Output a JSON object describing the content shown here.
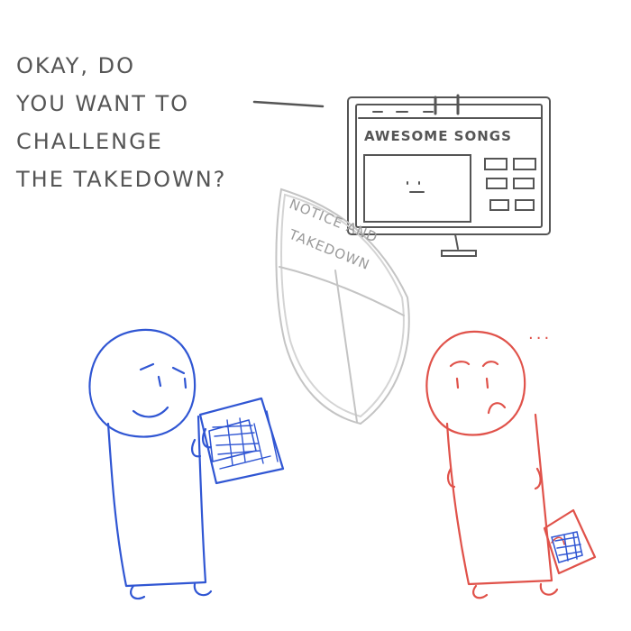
{
  "speech_bubble": {
    "lines": [
      "OKAY, DO",
      "YOU WANT TO",
      "CHALLENGE",
      "THE TAKEDOWN?"
    ]
  },
  "monitor": {
    "title": "AWESOME SONGS"
  },
  "shield": {
    "line1": "NOTICE AND",
    "line2": "TAKEDOWN"
  },
  "red_character": {
    "thought": "..."
  },
  "colors": {
    "blue_character": "#3056d3",
    "red_character": "#e0524a",
    "sketch_gray": "#555555",
    "shield_gray": "#bdbdbd"
  }
}
